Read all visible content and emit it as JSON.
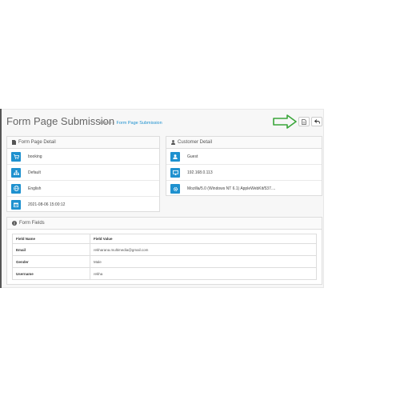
{
  "header": {
    "title": "Form Page Submission",
    "breadcrumb": {
      "home": "Home",
      "separator": "›",
      "current": "Form Page Submission"
    }
  },
  "toolbar": {
    "export_icon": "file-icon",
    "back_icon": "reply-icon"
  },
  "annotation": {
    "arrow_color": "#3aa63a"
  },
  "form_page_detail": {
    "heading": "Form Page Detail",
    "rows": [
      {
        "icon": "shopping-cart-icon",
        "value": "booking"
      },
      {
        "icon": "sitemap-icon",
        "value": "Default"
      },
      {
        "icon": "globe-icon",
        "value": "English"
      },
      {
        "icon": "calendar-icon",
        "value": "2021-08-06 15:00:12"
      }
    ]
  },
  "customer_detail": {
    "heading": "Customer Detail",
    "rows": [
      {
        "icon": "user-icon",
        "value": "Guest"
      },
      {
        "icon": "desktop-icon",
        "value": "192.168.0.113"
      },
      {
        "icon": "gear-icon",
        "value": "Mozilla/5.0 (Windows NT 6.1) AppleWebKit/537...."
      }
    ]
  },
  "form_fields": {
    "heading": "Form Fields",
    "columns": [
      "Field Name",
      "Field Value"
    ],
    "rows": [
      {
        "name": "Email",
        "value": "rekharana.multimedia@gmail.com"
      },
      {
        "name": "Gender",
        "value": "Male"
      },
      {
        "name": "Username",
        "value": "rekha"
      }
    ]
  },
  "colors": {
    "accent": "#1e91cf",
    "link": "#1e91cf"
  }
}
